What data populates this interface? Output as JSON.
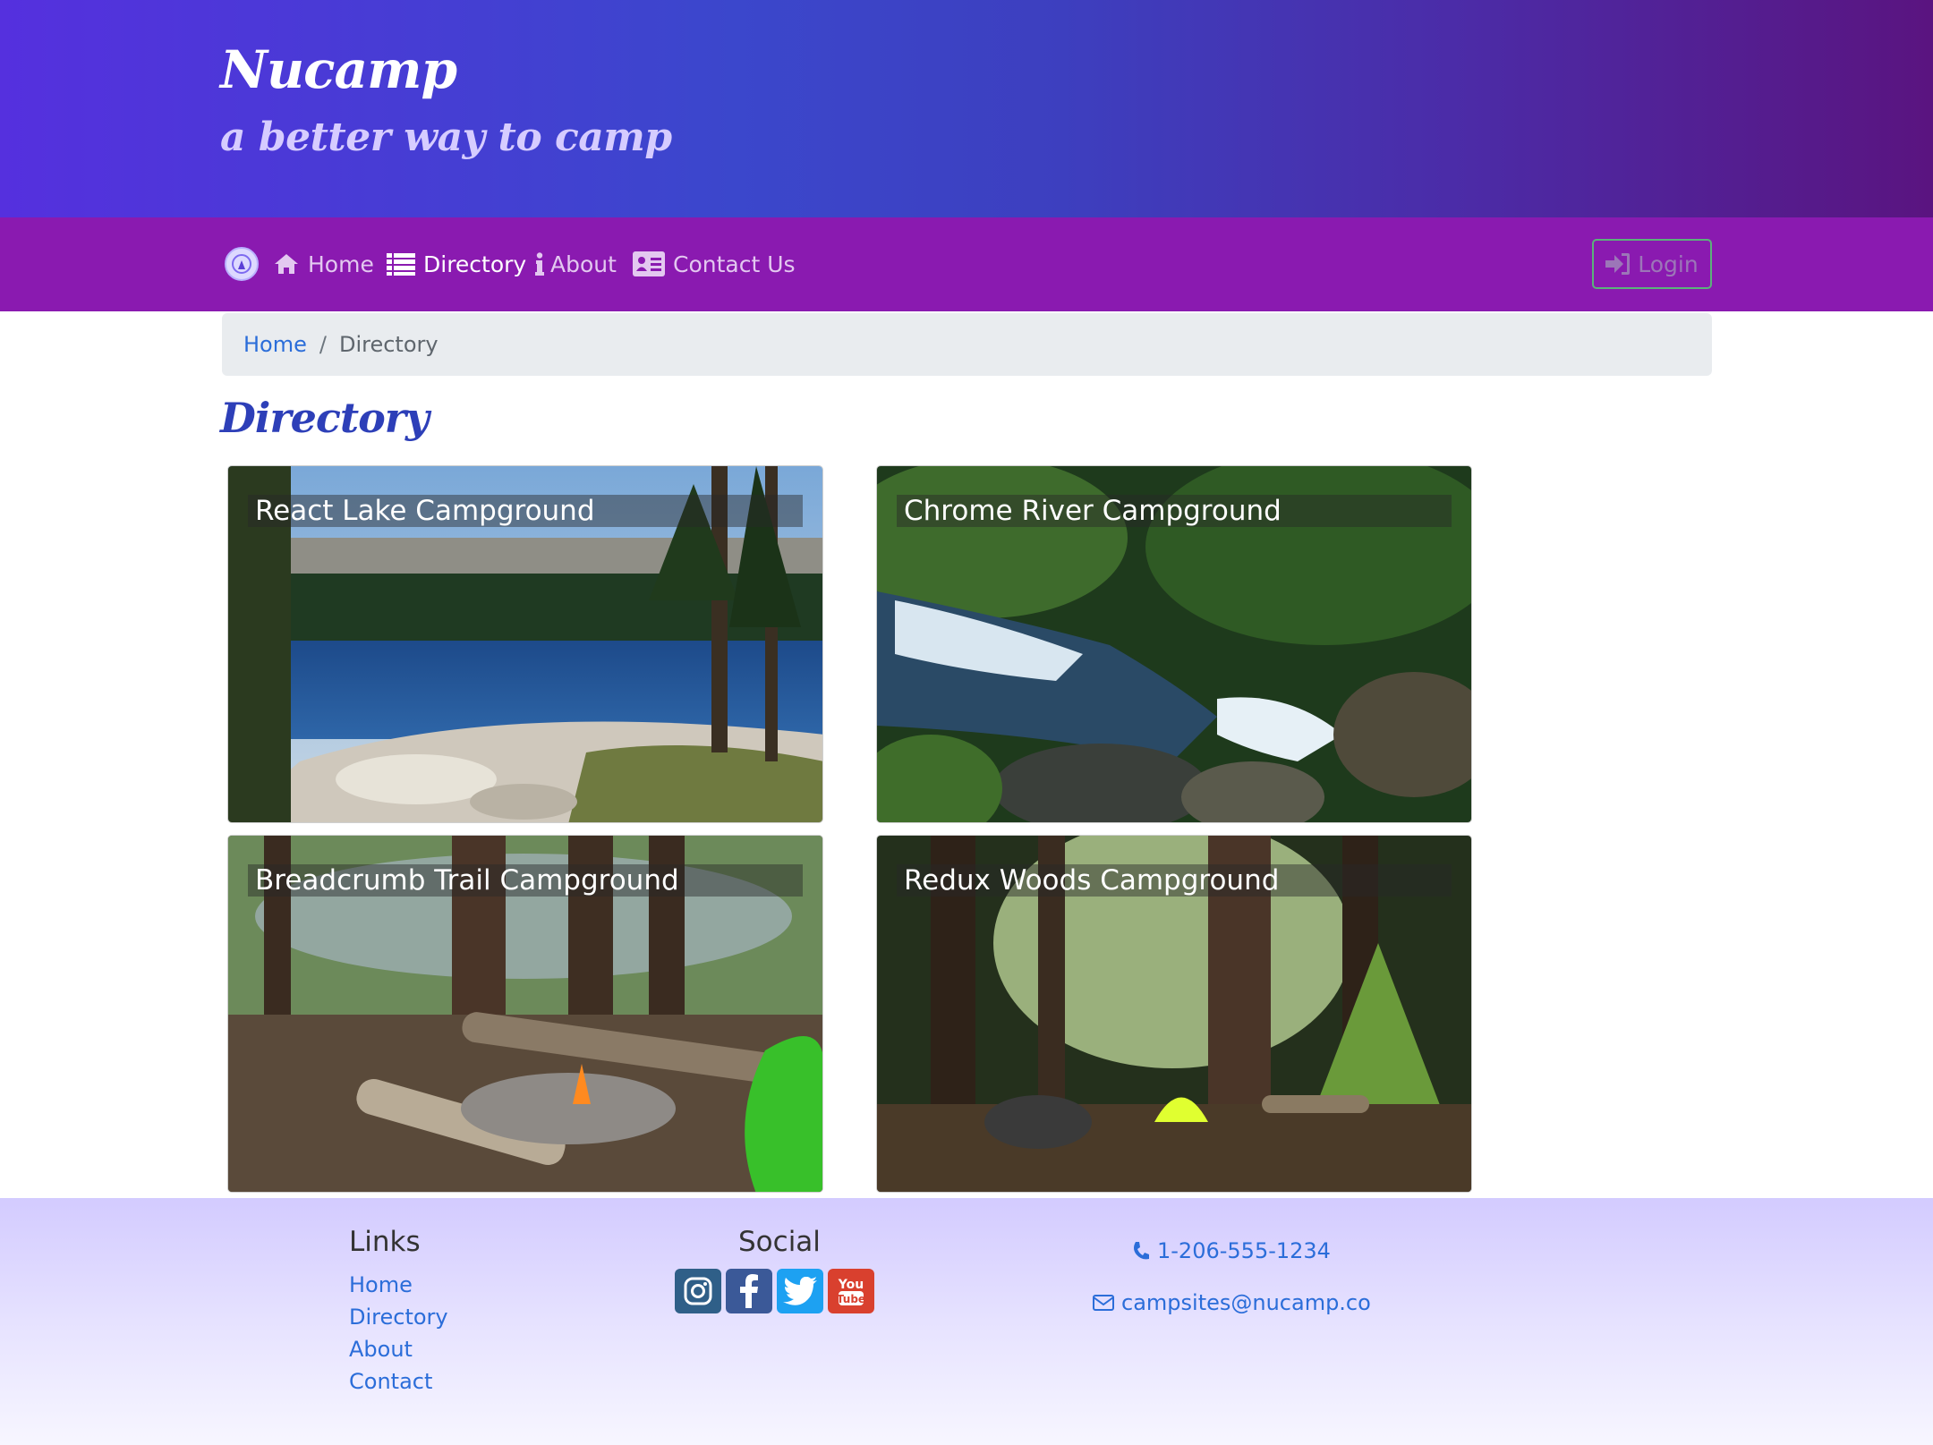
{
  "header": {
    "title": "Nucamp",
    "tagline": "a better way to camp"
  },
  "navbar": {
    "logo_icon": "nucamp-logo-icon",
    "items": [
      {
        "label": "Home",
        "icon": "home-icon",
        "active": false
      },
      {
        "label": "Directory",
        "icon": "list-icon",
        "active": true
      },
      {
        "label": "About",
        "icon": "info-icon",
        "active": false
      },
      {
        "label": "Contact Us",
        "icon": "address-card-icon",
        "active": false
      }
    ],
    "login_label": "Login",
    "login_icon": "sign-in-icon"
  },
  "breadcrumb": {
    "home": "Home",
    "separator": "/",
    "current": "Directory"
  },
  "page": {
    "heading": "Directory"
  },
  "campsites": [
    {
      "name": "React Lake Campground"
    },
    {
      "name": "Chrome River Campground"
    },
    {
      "name": "Breadcrumb Trail Campground"
    },
    {
      "name": "Redux Woods Campground"
    }
  ],
  "footer": {
    "links_heading": "Links",
    "links": [
      "Home",
      "Directory",
      "About",
      "Contact"
    ],
    "social_heading": "Social",
    "social": [
      {
        "icon": "instagram-icon",
        "color": "#2f5f88"
      },
      {
        "icon": "facebook-icon",
        "color": "#3b5998"
      },
      {
        "icon": "twitter-icon",
        "color": "#1da1f2"
      },
      {
        "icon": "youtube-icon",
        "color": "#d9402e"
      }
    ],
    "phone": "1-206-555-1234",
    "email": "campsites@nucamp.co"
  },
  "colors": {
    "navbar": "#8a1ab0",
    "link": "#2b6dd9",
    "heading": "#2d3fb8"
  }
}
